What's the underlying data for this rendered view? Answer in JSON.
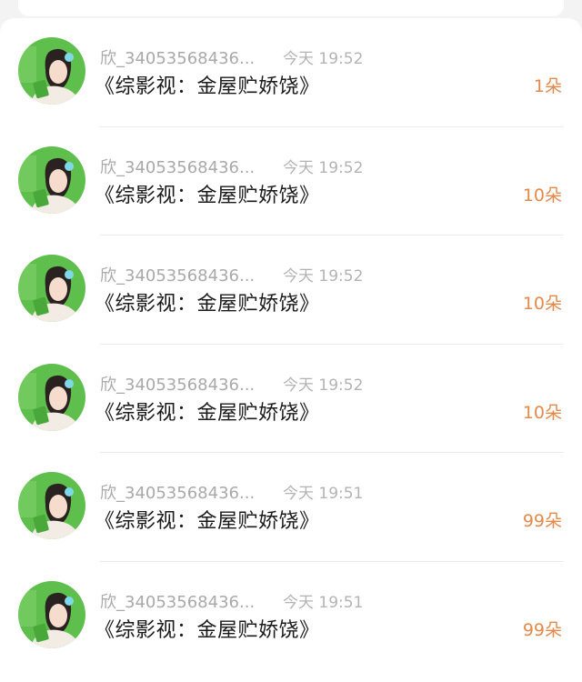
{
  "list": {
    "items": [
      {
        "name": "欣_34053568436...",
        "time": "今天 19:52",
        "title": "《综影视：金屋贮娇饶》",
        "count": "1朵"
      },
      {
        "name": "欣_34053568436...",
        "time": "今天 19:52",
        "title": "《综影视：金屋贮娇饶》",
        "count": "10朵"
      },
      {
        "name": "欣_34053568436...",
        "time": "今天 19:52",
        "title": "《综影视：金屋贮娇饶》",
        "count": "10朵"
      },
      {
        "name": "欣_34053568436...",
        "time": "今天 19:52",
        "title": "《综影视：金屋贮娇饶》",
        "count": "10朵"
      },
      {
        "name": "欣_34053568436...",
        "time": "今天 19:51",
        "title": "《综影视：金屋贮娇饶》",
        "count": "99朵"
      },
      {
        "name": "欣_34053568436...",
        "time": "今天 19:51",
        "title": "《综影视：金屋贮娇饶》",
        "count": "99朵"
      }
    ]
  },
  "colors": {
    "count": "#e4894a",
    "name": "#a9a9a9",
    "title": "#1a1a1a",
    "avatar_bg": "#5fbf4c"
  },
  "icons": {
    "avatar": "user-avatar-photo"
  }
}
